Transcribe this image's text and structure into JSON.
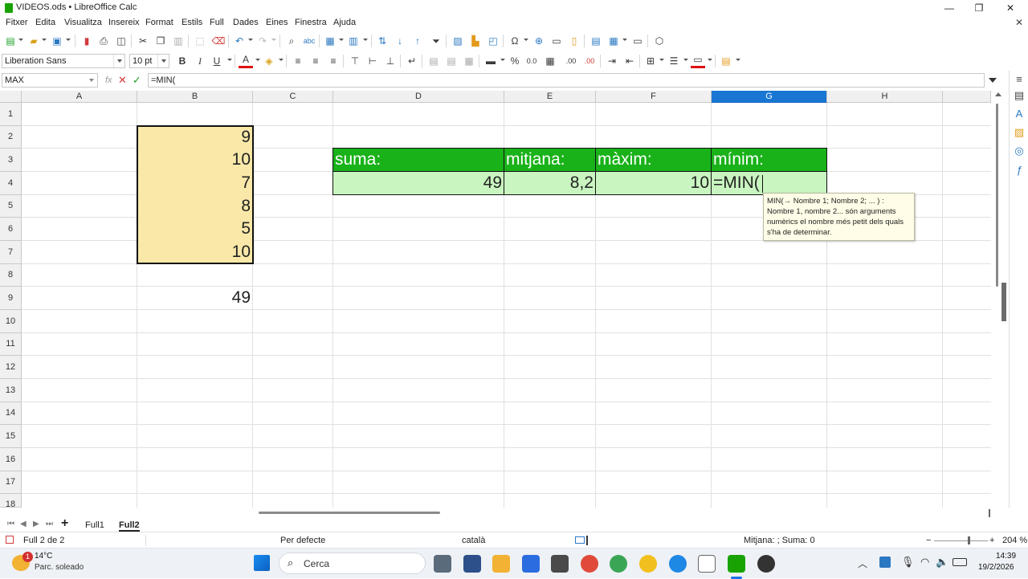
{
  "window": {
    "title": "VIDEOS.ods • LibreOffice Calc",
    "minimize": "—",
    "maximize": "❐",
    "close": "✕"
  },
  "menu": [
    "Fitxer",
    "Edita",
    "Visualitza",
    "Insereix",
    "Format",
    "Estils",
    "Full",
    "Dades",
    "Eines",
    "Finestra",
    "Ajuda"
  ],
  "format_toolbar": {
    "font_name": "Liberation Sans",
    "font_size": "10 pt",
    "bold": "B",
    "italic": "I",
    "underline": "U",
    "font_color": "A",
    "percent": "%",
    "number_format": "0.0",
    "decimals_add": ".00",
    "decimals_del": ".00"
  },
  "formula_bar": {
    "name_box": "MAX",
    "fx": "fx",
    "cancel": "✕",
    "accept": "✓",
    "content": "=MIN("
  },
  "columns": [
    "A",
    "B",
    "C",
    "D",
    "E",
    "F",
    "G",
    "H"
  ],
  "selected_column": "G",
  "rows": [
    "1",
    "2",
    "3",
    "4",
    "5",
    "6",
    "7",
    "8",
    "9",
    "10",
    "11",
    "12",
    "13",
    "14",
    "15",
    "16",
    "17",
    "18"
  ],
  "cells": {
    "B2": "9",
    "B3": "10",
    "B4": "7",
    "B5": "8",
    "B6": "5",
    "B7": "10",
    "B9": "49",
    "D3": "suma:",
    "E3": "mitjana:",
    "F3": "màxim:",
    "G3": "mínim:",
    "D4": "49",
    "E4": "8,2",
    "F4": "10",
    "G4": "=MIN("
  },
  "colors": {
    "header_green": "#19b219",
    "result_green": "#c9f5c0",
    "data_yellow": "#f9e8a8",
    "selected_header": "#1976d2"
  },
  "tooltip": {
    "line1": "MIN(→ Nombre 1; Nombre 2; ... ) :",
    "line2": "Nombre 1, nombre 2... són arguments",
    "line3": "numèrics el nombre més petit dels quals",
    "line4": "s'ha de determinar."
  },
  "sheet_tabs": {
    "add": "+",
    "tabs": [
      "Full1",
      "Full2"
    ],
    "active": "Full2"
  },
  "status": {
    "sheet": "Full 2 de 2",
    "page_style": "Per defecte",
    "language": "català",
    "summary": "Mitjana: ; Suma: 0",
    "zoom": "204 %",
    "zoom_minus": "−",
    "zoom_plus": "+"
  },
  "taskbar": {
    "weather_badge": "1",
    "temperature": "14°C",
    "weather": "Parc. soleado",
    "search_placeholder": "Cerca",
    "time": "14:39",
    "date": "19/2/2026"
  }
}
